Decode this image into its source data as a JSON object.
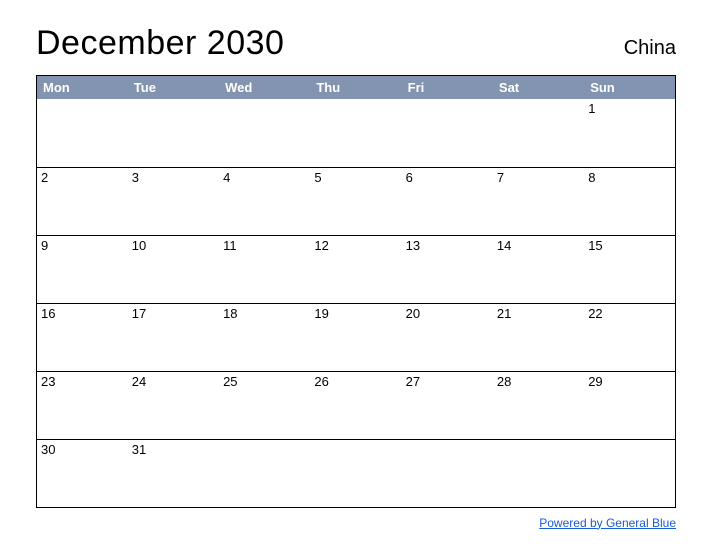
{
  "title": "December 2030",
  "region": "China",
  "days": [
    "Mon",
    "Tue",
    "Wed",
    "Thu",
    "Fri",
    "Sat",
    "Sun"
  ],
  "weeks": [
    [
      "",
      "",
      "",
      "",
      "",
      "",
      "1"
    ],
    [
      "2",
      "3",
      "4",
      "5",
      "6",
      "7",
      "8"
    ],
    [
      "9",
      "10",
      "11",
      "12",
      "13",
      "14",
      "15"
    ],
    [
      "16",
      "17",
      "18",
      "19",
      "20",
      "21",
      "22"
    ],
    [
      "23",
      "24",
      "25",
      "26",
      "27",
      "28",
      "29"
    ],
    [
      "30",
      "31",
      "",
      "",
      "",
      "",
      ""
    ]
  ],
  "footer_link": "Powered by General Blue"
}
